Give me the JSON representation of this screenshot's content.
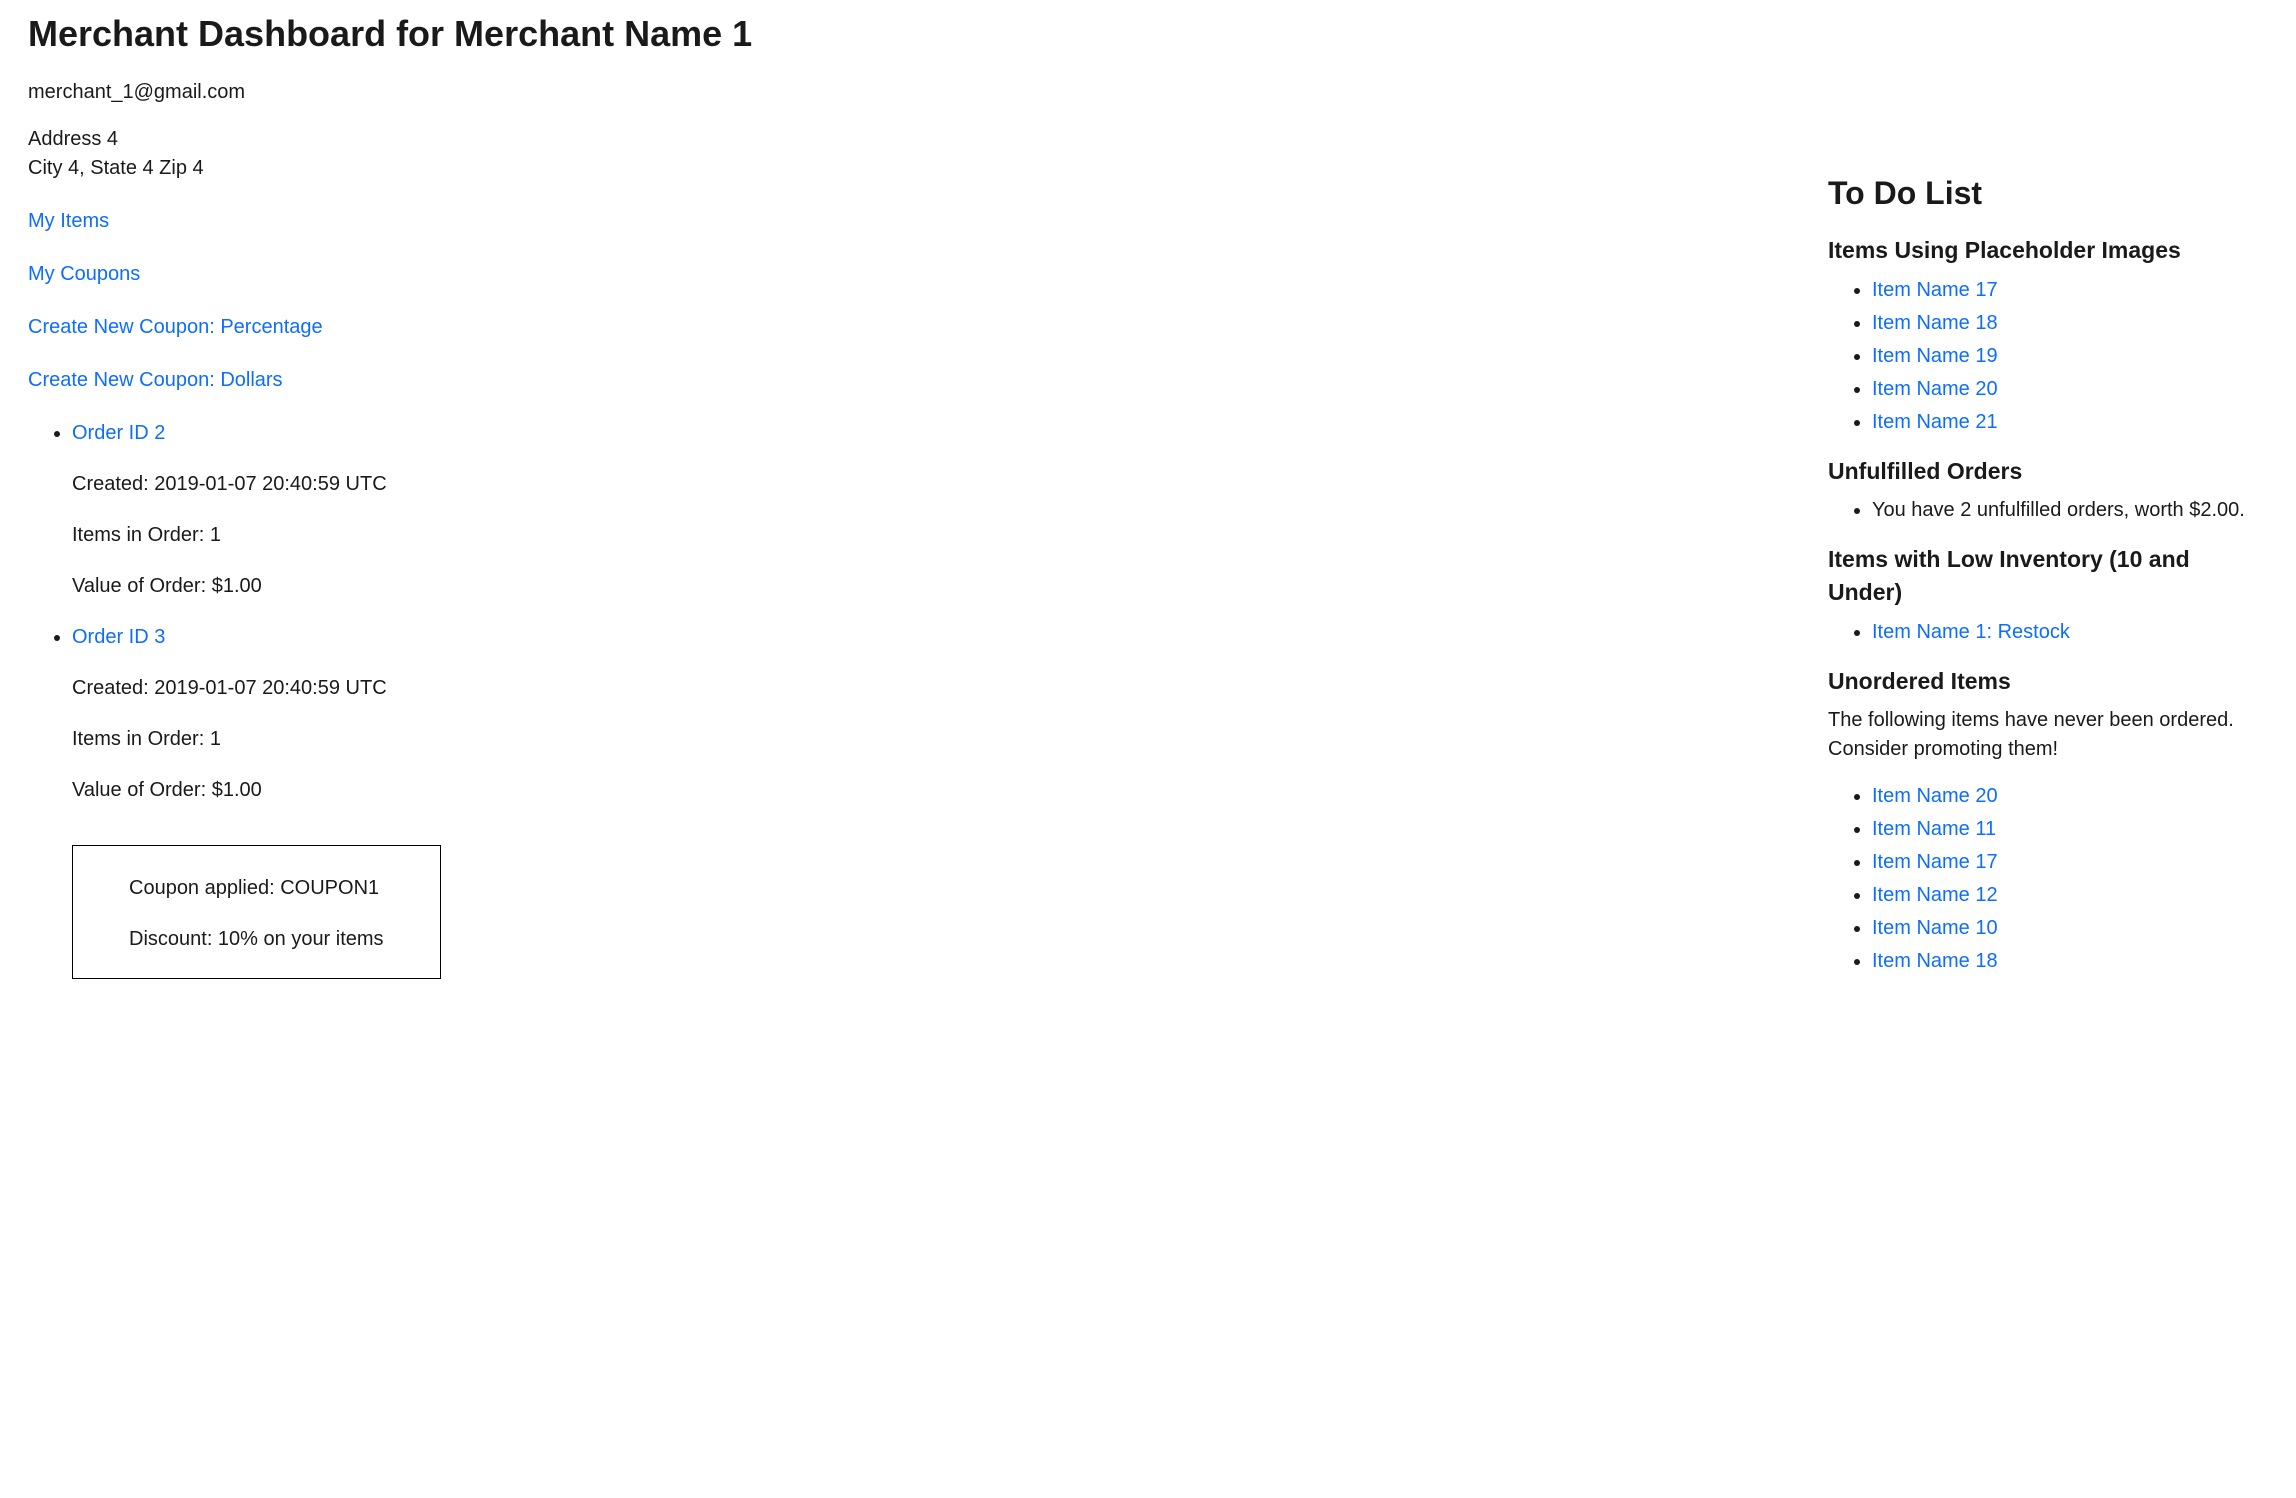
{
  "header": {
    "title": "Merchant Dashboard for Merchant Name 1",
    "email": "merchant_1@gmail.com",
    "address_line1": "Address 4",
    "address_line2": "City 4, State 4 Zip 4"
  },
  "nav": {
    "my_items": "My Items",
    "my_coupons": "My Coupons",
    "create_pct": "Create New Coupon: Percentage",
    "create_dollar": "Create New Coupon: Dollars"
  },
  "orders": [
    {
      "link": "Order ID 2",
      "created": "Created: 2019-01-07 20:40:59 UTC",
      "items": "Items in Order: 1",
      "value": "Value of Order: $1.00",
      "coupon": null
    },
    {
      "link": "Order ID 3",
      "created": "Created: 2019-01-07 20:40:59 UTC",
      "items": "Items in Order: 1",
      "value": "Value of Order: $1.00",
      "coupon": {
        "applied": "Coupon applied: COUPON1",
        "discount": "Discount: 10% on your items"
      }
    }
  ],
  "todo": {
    "title": "To Do List",
    "placeholder_heading": "Items Using Placeholder Images",
    "placeholder_items": [
      "Item Name 17",
      "Item Name 18",
      "Item Name 19",
      "Item Name 20",
      "Item Name 21"
    ],
    "unfulfilled_heading": "Unfulfilled Orders",
    "unfulfilled_text": "You have 2 unfulfilled orders, worth $2.00.",
    "low_inv_heading": "Items with Low Inventory (10 and Under)",
    "low_inv_items": [
      "Item Name 1: Restock"
    ],
    "unordered_heading": "Unordered Items",
    "unordered_text": "The following items have never been ordered. Consider promoting them!",
    "unordered_items": [
      "Item Name 20",
      "Item Name 11",
      "Item Name 17",
      "Item Name 12",
      "Item Name 10",
      "Item Name 18"
    ]
  }
}
